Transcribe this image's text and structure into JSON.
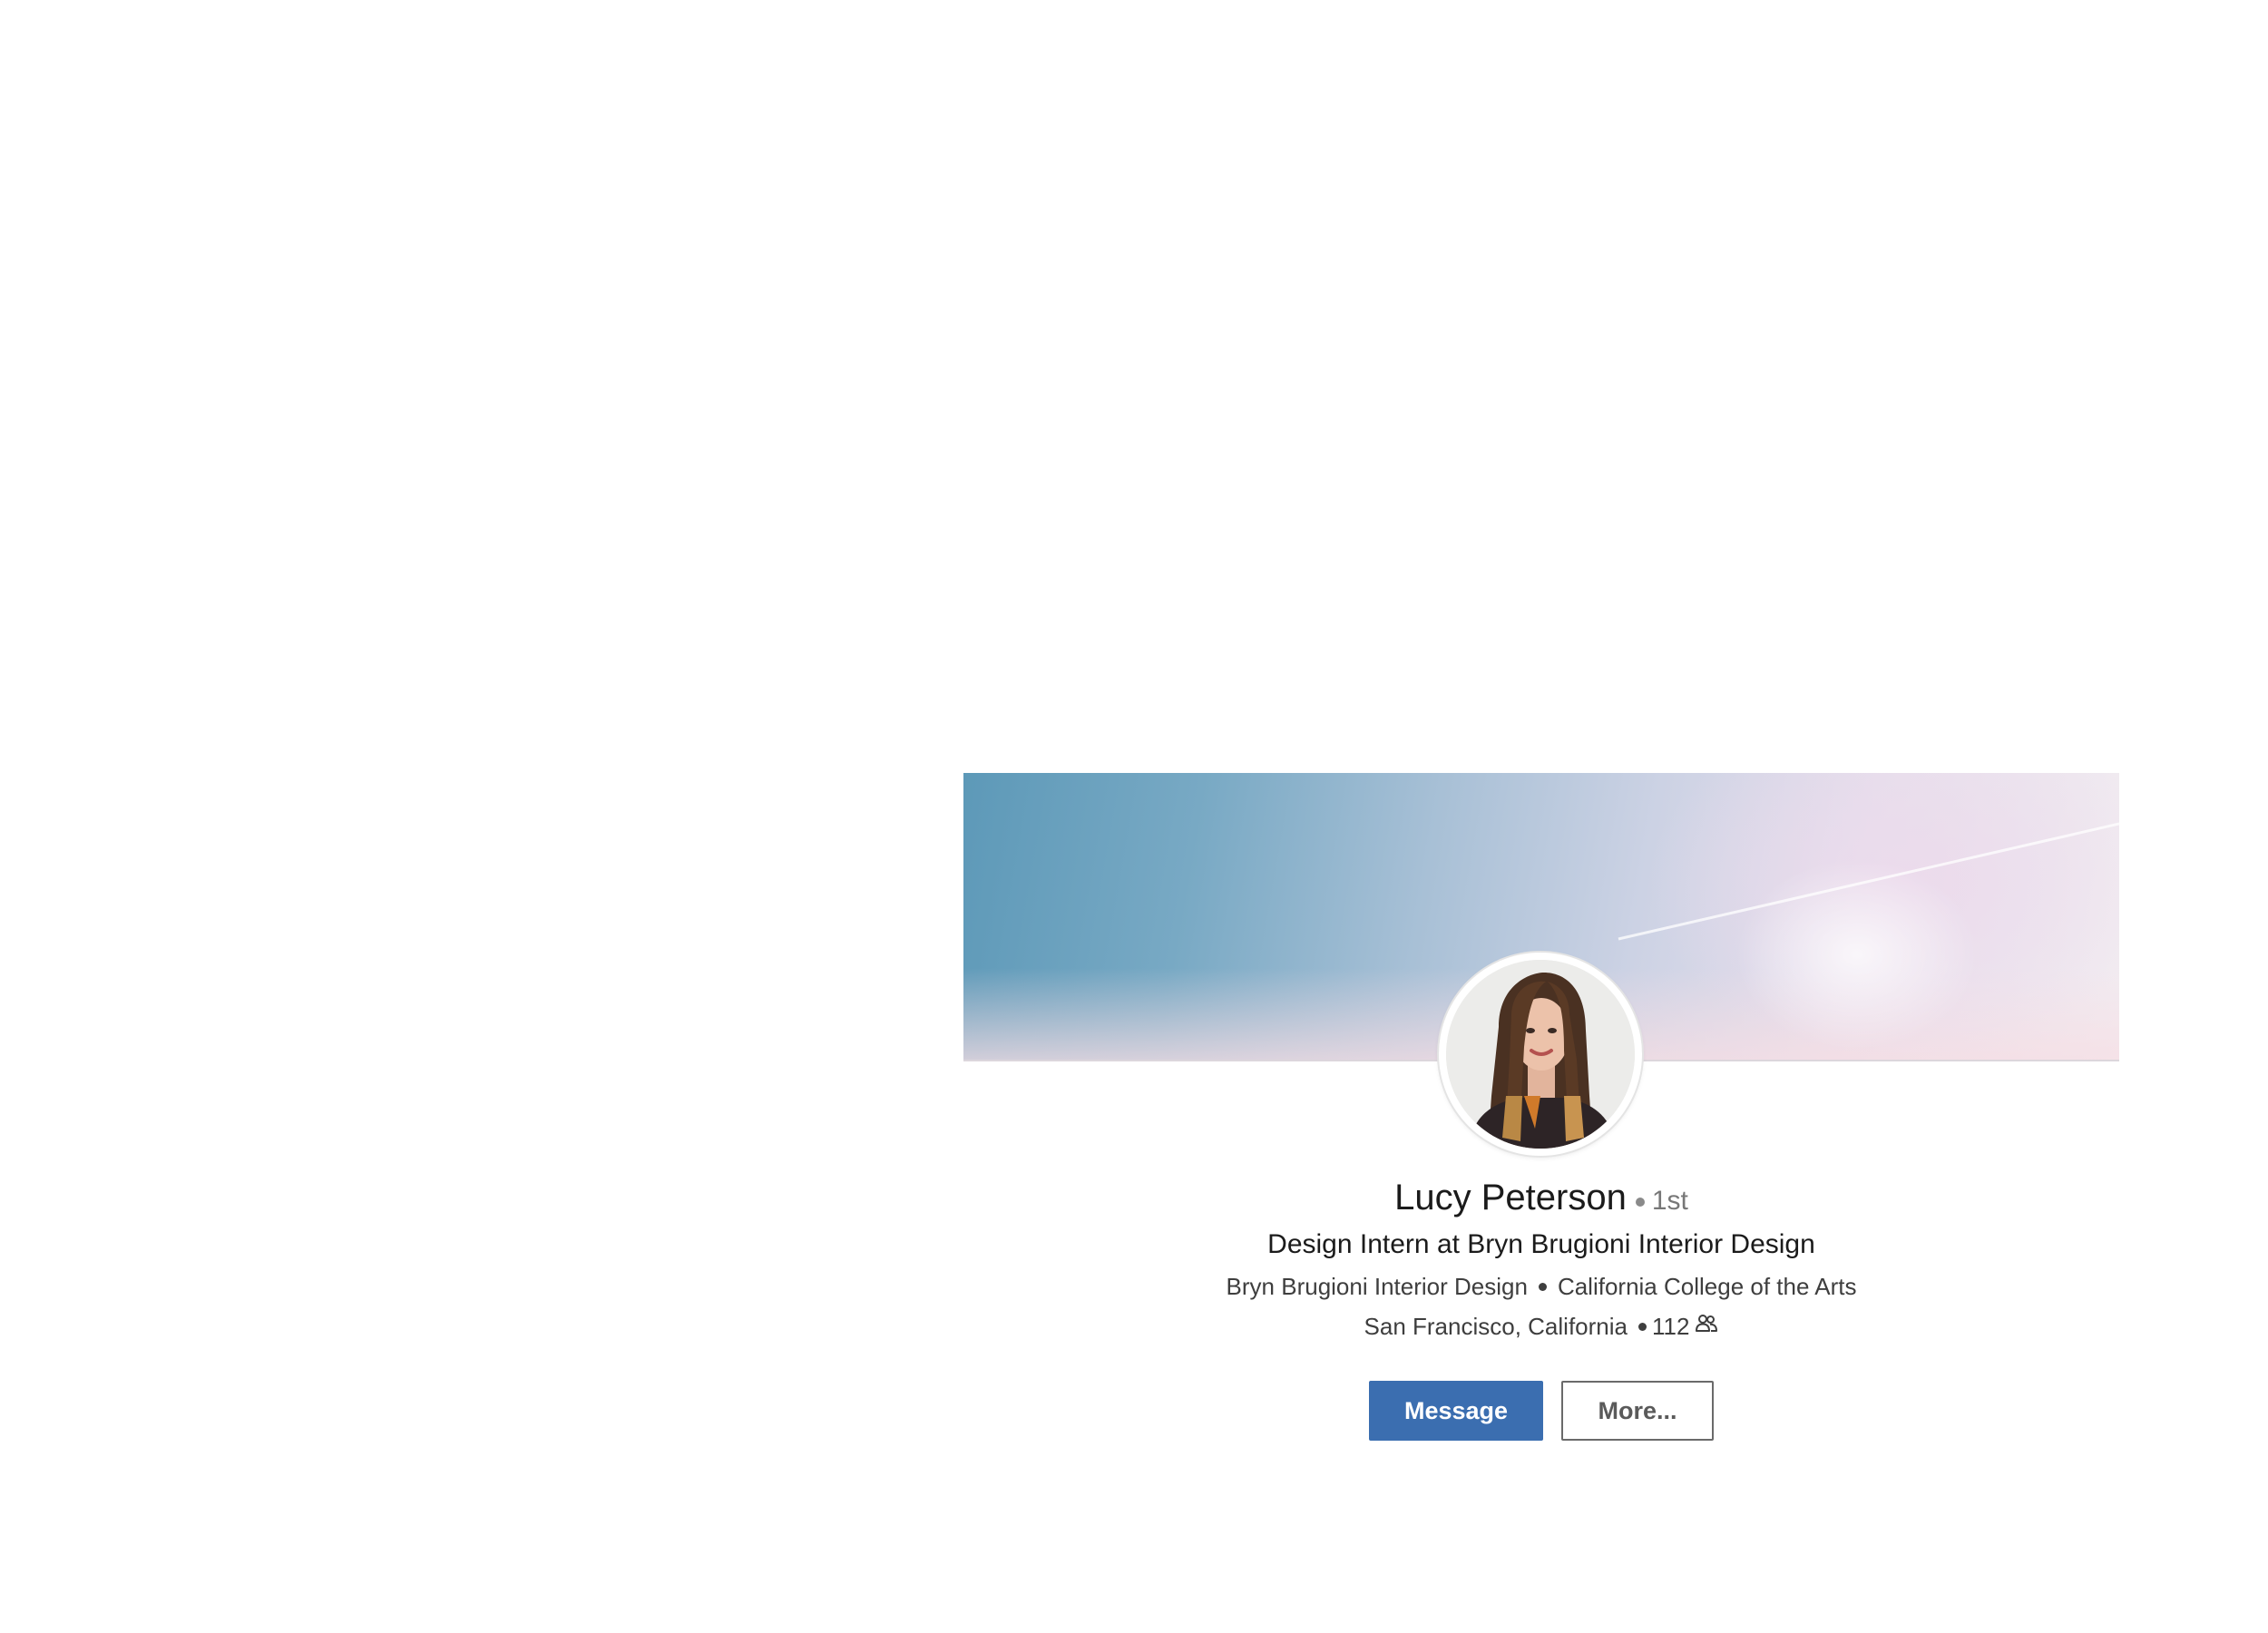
{
  "colors": {
    "primary_button": "#3b6eb0",
    "primary_button_text": "#ffffff",
    "secondary_button_border": "#6a6a6a",
    "background": "#ffffff"
  },
  "profile": {
    "name": "Lucy Peterson",
    "connection_degree": "1st",
    "headline": "Design Intern at Bryn Brugioni Interior Design",
    "company": "Bryn Brugioni Interior Design",
    "school": "California College of the Arts",
    "location": "San Francisco, California",
    "connections_count": "112",
    "connections_icon": "people-icon",
    "avatar_icon": "profile-photo"
  },
  "actions": {
    "message_label": "Message",
    "more_label": "More..."
  }
}
